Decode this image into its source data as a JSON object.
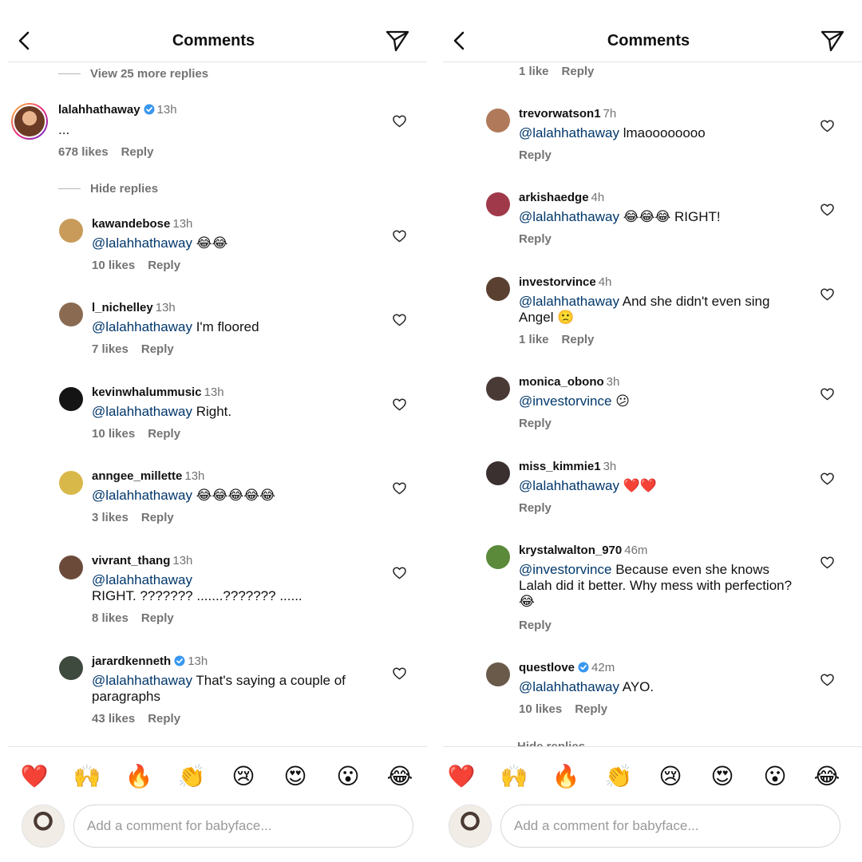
{
  "panels": [
    {
      "title": "Comments",
      "view_more": "View 25 more replies",
      "main": {
        "user": "lalahhathaway",
        "verified": true,
        "time": "13h",
        "text": "...",
        "likes": "678 likes",
        "reply": "Reply"
      },
      "hide_replies": "Hide replies",
      "replies": [
        {
          "user": "kawandebose",
          "time": "13h",
          "mention": "@lalahhathaway",
          "text": "😂😂",
          "likes": "10 likes",
          "reply": "Reply",
          "avatar_color": "#c89b5a"
        },
        {
          "user": "l_nichelley",
          "time": "13h",
          "mention": "@lalahhathaway",
          "text": "I'm floored",
          "likes": "7 likes",
          "reply": "Reply",
          "avatar_color": "#8a6b52"
        },
        {
          "user": "kevinwhalummusic",
          "time": "13h",
          "mention": "@lalahhathaway",
          "text": "Right.",
          "likes": "10 likes",
          "reply": "Reply",
          "avatar_color": "#141414"
        },
        {
          "user": "anngee_millette",
          "time": "13h",
          "mention": "@lalahhathaway",
          "text": "😂😂😂😂😂",
          "likes": "3 likes",
          "reply": "Reply",
          "avatar_color": "#d9b84a"
        },
        {
          "user": "vivrant_thang",
          "time": "13h",
          "mention": "@lalahhathaway",
          "text": "RIGHT. ??????? .......??????? ......",
          "likes": "8 likes",
          "reply": "Reply",
          "avatar_color": "#6b4a3a"
        },
        {
          "user": "jarardkenneth",
          "verified": true,
          "time": "13h",
          "mention": "@lalahhathaway",
          "text": "That's saying a couple of paragraphs",
          "likes": "43 likes",
          "reply": "Reply",
          "avatar_color": "#3f4a3f"
        }
      ],
      "emojis": [
        "❤️",
        "🙌",
        "🔥",
        "👏",
        "😢",
        "😍",
        "😮",
        "😂"
      ],
      "input_placeholder": "Add a comment for babyface..."
    },
    {
      "title": "Comments",
      "top_actions": {
        "likes": "1 like",
        "reply": "Reply"
      },
      "replies": [
        {
          "user": "trevorwatson1",
          "time": "7h",
          "mention": "@lalahhathaway",
          "text": "lmaoooooooo",
          "likes": "",
          "reply": "Reply",
          "avatar_color": "#b07a5a"
        },
        {
          "user": "arkishaedge",
          "time": "4h",
          "mention": "@lalahhathaway",
          "text": "😂😂😂 RIGHT!",
          "likes": "",
          "reply": "Reply",
          "avatar_color": "#a03a4a"
        },
        {
          "user": "investorvince",
          "time": "4h",
          "mention": "@lalahhathaway",
          "text": "And she didn't even sing Angel 🙁",
          "likes": "1 like",
          "reply": "Reply",
          "avatar_color": "#5a4030"
        },
        {
          "user": "monica_obono",
          "time": "3h",
          "mention": "@investorvince",
          "text": "😕",
          "likes": "",
          "reply": "Reply",
          "avatar_color": "#4a3a35"
        },
        {
          "user": "miss_kimmie1",
          "time": "3h",
          "mention": "@lalahhathaway",
          "text": "❤️❤️",
          "likes": "",
          "reply": "Reply",
          "avatar_color": "#3a3030"
        },
        {
          "user": "krystalwalton_970",
          "time": "46m",
          "mention": "@investorvince",
          "text": "Because even she knows Lalah did it better. Why mess with perfection? 😂",
          "likes": "",
          "reply": "Reply",
          "avatar_color": "#5a8a3a"
        },
        {
          "user": "questlove",
          "verified": true,
          "time": "42m",
          "mention": "@lalahhathaway",
          "text": "AYO.",
          "likes": "10 likes",
          "reply": "Reply",
          "avatar_color": "#6a5a4a"
        }
      ],
      "hide_replies": "Hide replies",
      "emojis": [
        "❤️",
        "🙌",
        "🔥",
        "👏",
        "😢",
        "😍",
        "😮",
        "😂"
      ],
      "input_placeholder": "Add a comment for babyface..."
    }
  ],
  "colors": {
    "mention": "#00376b",
    "muted": "#737373",
    "verified": "#3897f0"
  },
  "icons": {
    "back": "chevron-left-icon",
    "send": "paper-plane-icon",
    "like": "heart-outline-icon",
    "verified": "verified-badge-icon"
  }
}
